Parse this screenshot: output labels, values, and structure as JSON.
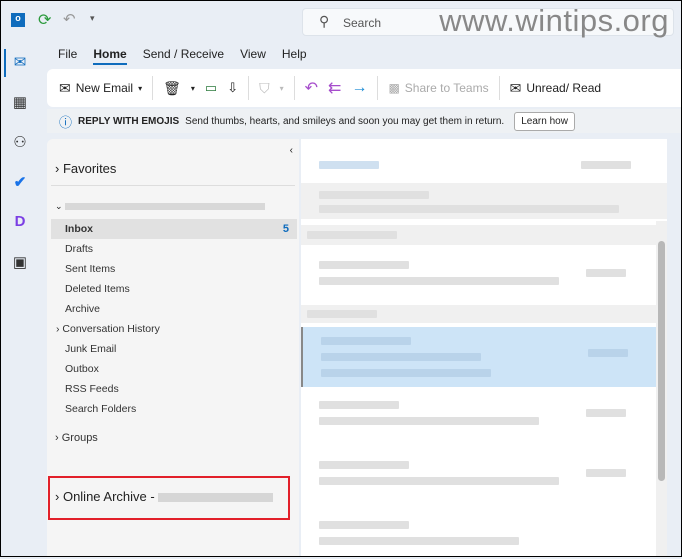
{
  "top": {
    "search_placeholder": "Search",
    "watermark": "www.wintips.org"
  },
  "menu": [
    "File",
    "Home",
    "Send / Receive",
    "View",
    "Help"
  ],
  "ribbon": {
    "new_email": "New Email",
    "share_teams": "Share to Teams",
    "unread_read": "Unread/ Read"
  },
  "info": {
    "title": "REPLY WITH EMOJIS",
    "text": "Send thumbs, hearts, and smileys and soon you may get them in return.",
    "button": "Learn how"
  },
  "folders": {
    "favorites": "Favorites",
    "inbox": "Inbox",
    "inbox_count": "5",
    "items": [
      "Drafts",
      "Sent Items",
      "Deleted Items",
      "Archive",
      "Conversation History",
      "Junk Email",
      "Outbox",
      "RSS Feeds",
      "Search Folders"
    ],
    "groups": "Groups",
    "online_archive": "Online Archive -"
  },
  "colors": {
    "accent": "#0f6cbd",
    "highlight": "#e2202a",
    "selected": "#cde4f7"
  }
}
